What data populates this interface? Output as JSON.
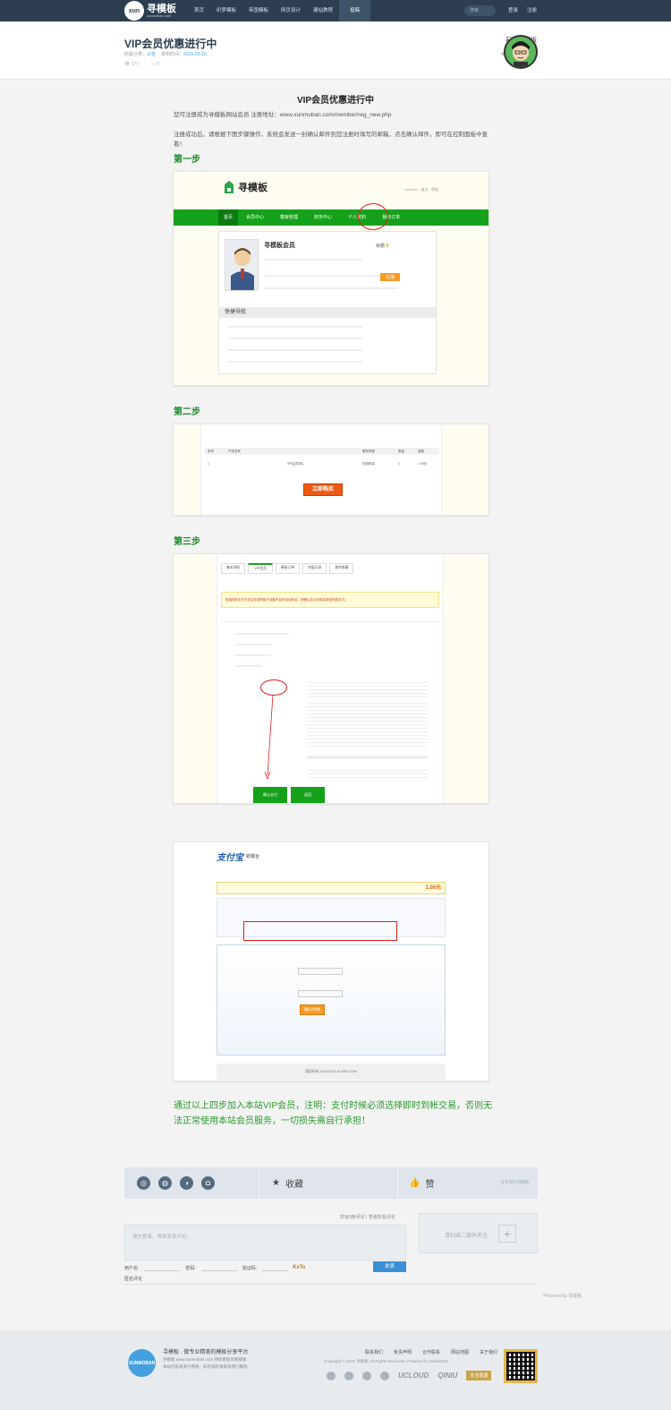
{
  "nav": {
    "logo_text": "xun",
    "brand": "寻模板",
    "domain": "xunmoban.com",
    "items": [
      "首页",
      "织梦模板",
      "帝国模板",
      "网页设计",
      "建站教程",
      "投稿"
    ],
    "search_placeholder": "搜索",
    "login": "登录",
    "register": "注册"
  },
  "header": {
    "title": "VIP会员优惠进行中",
    "category_label": "所属分类：",
    "category": "公告",
    "date_label": "发布时间：",
    "date": "2015-03-10",
    "views": "177",
    "comments": "0",
    "author_name": "石墨寻模板",
    "author_desc": "寻模板优质模板资源"
  },
  "article": {
    "heading": "VIP会员优惠进行中",
    "p1": "您可注册成为寻模板网站会员 注册地址：www.xunmoban.com/member/reg_new.php",
    "p2": "注册成功后，请根据下图步骤操作，系统会发送一封确认邮件到您注册时填写的邮箱，点击确认邮件，即可在控制面板中查看！",
    "step1": "第一步",
    "step2": "第二步",
    "step3": "第三步",
    "final": "通过以上四步加入本站VIP会员，注明：支付时候必须选择即时到帐交易，否则无法正常使用本站会员服务，一切损失需自行承担！",
    "shot1": {
      "brand": "寻模板",
      "menu": [
        "首页",
        "会员中心",
        "模板管理",
        "财务中心",
        "个人资料",
        "我的订单"
      ],
      "profile_name": "寻模板会员",
      "section": "快捷导航",
      "balance_label": "余额",
      "balance": "0",
      "btn": "充值"
    },
    "shot2": {
      "head": [
        "序号",
        "产品名称",
        "服务类型",
        "数量",
        "金额"
      ],
      "row": [
        "1",
        "VIP会员(年)",
        "在线购买",
        "1",
        "1.00元"
      ],
      "btn": "立即购买"
    },
    "shot3": {
      "tabs": [
        "基本资料",
        "VIP会员",
        "模板订单",
        "充值记录",
        "我的收藏"
      ],
      "warn": "您选择的支付方式会在您的账户余额不足时自动补足，请确认后点击购买按钮完成支付。",
      "btn1": "确认支付",
      "btn2": "返回"
    },
    "shot4": {
      "brand": "支付宝",
      "cashier": "收银台",
      "amount": "1.00元",
      "btn": "确认付款",
      "footer": "版权所有 2004-2015 ALIPAY.COM"
    }
  },
  "share": {
    "fav": "收藏",
    "like": "赞",
    "note": "分享到社交网络"
  },
  "comment": {
    "top": "共有0条评论 | 查看所有评论",
    "placeholder": "请先登录，再来发表评论。",
    "user_label": "用户名:",
    "pwd_label": "密码:",
    "code_label": "验证码:",
    "captcha": "KxTs",
    "submit": "发表",
    "anon_label": "匿名评论",
    "scan_text": "请扫描二维码关注",
    "powered": "Powered by 寻模板"
  },
  "footer": {
    "logo": "XUNMOBAN",
    "title": "寻模板 · 做专业精美的模板分享平台",
    "line1": "寻模板 www.xunmoban.com 持续更新优质模板",
    "line2": "本站内容来源于网络，如有侵权请联系我们删除",
    "links": [
      "联系我们",
      "免责声明",
      "合作联系",
      "网站地图",
      "关于我们"
    ],
    "copy": "Copyright © 2015 寻模板 All Rights Reserved. Powered by DedeCMS",
    "partners": [
      "UCLOUD",
      "QINIU",
      "安全联盟"
    ]
  },
  "colors": {
    "topbar": "#2c3e50",
    "accent_green": "#1b8a2c",
    "link_blue": "#4aa3df"
  }
}
